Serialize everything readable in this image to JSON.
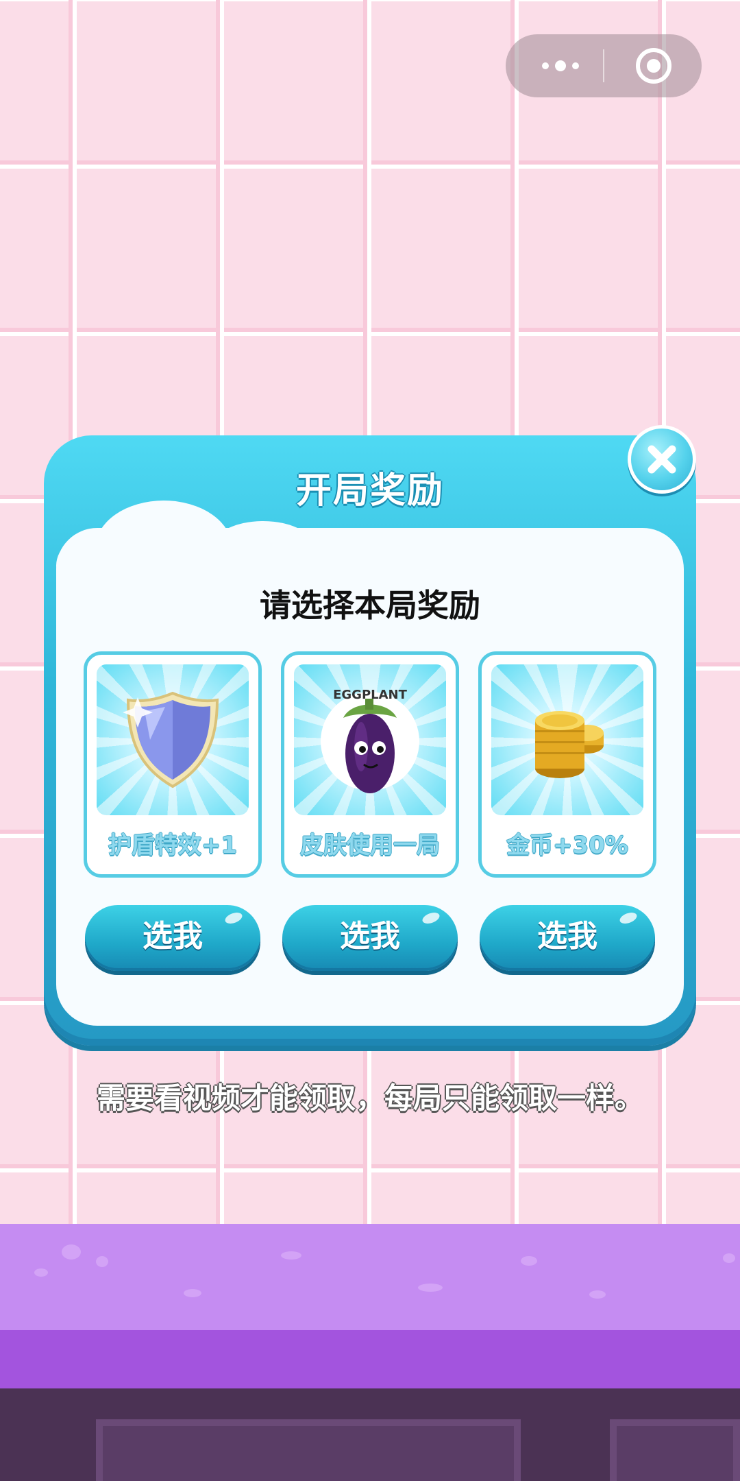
{
  "capsule": {
    "more_icon": "more-dots-icon",
    "exit_icon": "target-circle-icon"
  },
  "dialog": {
    "title": "开局奖励",
    "prompt": "请选择本局奖励",
    "close_icon": "close-x-icon",
    "rewards": [
      {
        "label": "护盾特效+1",
        "icon": "shield-icon",
        "button": "选我"
      },
      {
        "label": "皮肤使用一局",
        "icon": "eggplant-icon",
        "art_text": "EGGPLANT",
        "button": "选我"
      },
      {
        "label": "金币+30%",
        "icon": "gold-coins-icon",
        "button": "选我"
      }
    ]
  },
  "hint": "需要看视频才能领取，每局只能领取一样。",
  "colors": {
    "wall": "#fbdde8",
    "dialog": "#2fb7d9",
    "button": "#1fa8c9",
    "floor": "#c58cf2"
  }
}
